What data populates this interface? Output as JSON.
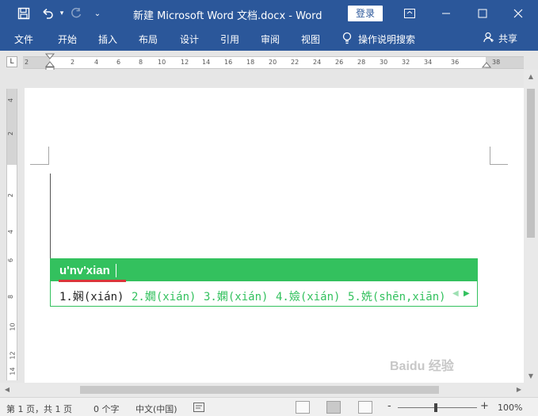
{
  "titlebar": {
    "title": "新建 Microsoft Word 文档.docx  -  Word",
    "login_label": "登录"
  },
  "tabs": [
    {
      "label": "文件"
    },
    {
      "label": "开始"
    },
    {
      "label": "插入"
    },
    {
      "label": "布局"
    },
    {
      "label": "设计"
    },
    {
      "label": "引用"
    },
    {
      "label": "审阅"
    },
    {
      "label": "视图"
    }
  ],
  "tellme": {
    "label": "操作说明搜索"
  },
  "share": {
    "label": "共享"
  },
  "ruler": {
    "corner": "L",
    "numbers": [
      "2",
      "2",
      "4",
      "6",
      "8",
      "10",
      "12",
      "14",
      "16",
      "18",
      "20",
      "22",
      "24",
      "26",
      "28",
      "30",
      "32",
      "34",
      "36",
      "38"
    ],
    "v_numbers": [
      "4",
      "2",
      "2",
      "4",
      "6",
      "8",
      "10",
      "12",
      "14"
    ]
  },
  "ime": {
    "input": "u'nv'xian",
    "candidates": [
      {
        "text": "1.娴(xián)"
      },
      {
        "text": "2.嫺(xián)"
      },
      {
        "text": "3.嫻(xián)"
      },
      {
        "text": "4.嬐(xián)"
      },
      {
        "text": "5.姺(shēn,xiān)"
      }
    ]
  },
  "status": {
    "page": "第 1 页，共 1 页",
    "words": "0 个字",
    "language": "中文(中国)",
    "zoom_minus": "-",
    "zoom_plus": "+",
    "zoom": "100%"
  },
  "watermark": "Baidu 经验"
}
